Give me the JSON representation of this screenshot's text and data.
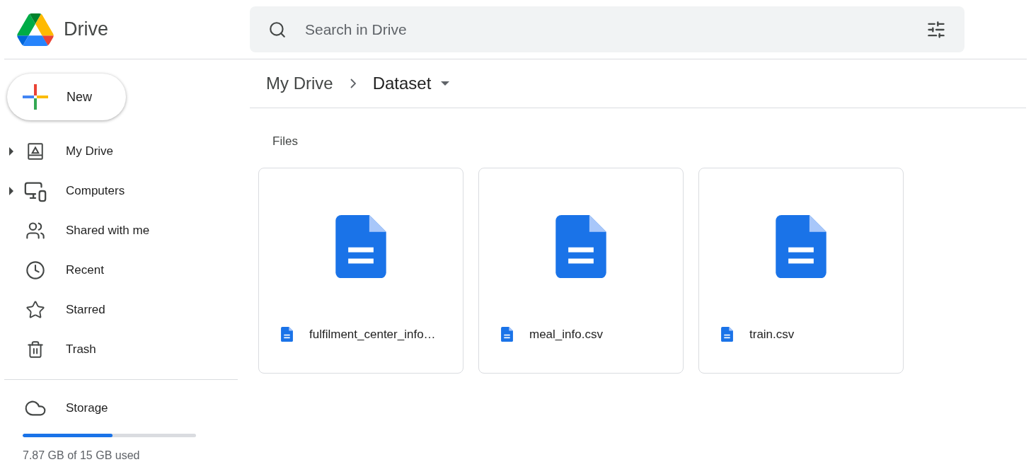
{
  "app": {
    "name": "Drive"
  },
  "search": {
    "placeholder": "Search in Drive"
  },
  "new_button": {
    "label": "New"
  },
  "sidebar": {
    "items": [
      {
        "label": "My Drive",
        "expandable": true
      },
      {
        "label": "Computers",
        "expandable": true
      },
      {
        "label": "Shared with me",
        "expandable": false
      },
      {
        "label": "Recent",
        "expandable": false
      },
      {
        "label": "Starred",
        "expandable": false
      },
      {
        "label": "Trash",
        "expandable": false
      }
    ]
  },
  "storage": {
    "label": "Storage",
    "level": 0.52,
    "reading": "7.87 GB of 15 GB used"
  },
  "breadcrumb": [
    {
      "label": "My Drive"
    },
    {
      "label": "Dataset"
    }
  ],
  "section": {
    "title": "Files"
  },
  "files": [
    {
      "name": "fulfilment_center_info…"
    },
    {
      "name": "meal_info.csv"
    },
    {
      "name": "train.csv"
    }
  ]
}
